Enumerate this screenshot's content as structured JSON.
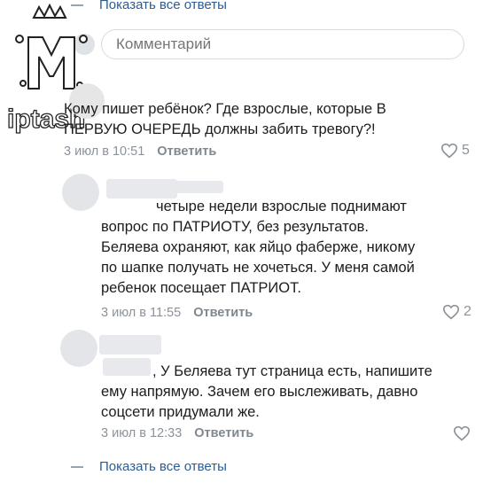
{
  "thread": {
    "show_all_top": "Показать все ответы",
    "show_all_bottom": "Показать все ответы",
    "comment_placeholder": "Комментарий"
  },
  "watermark": {
    "text": "iptash"
  },
  "comments": [
    {
      "text": "Кому пишет ребёнок? Где взрослые, которые В\nПЕРВУЮ ОЧЕРЕДЬ должны забить тревогу?!",
      "time": "3 июл в 10:51",
      "reply": "Ответить",
      "likes": "5"
    },
    {
      "text": "четыре недели взрослые поднимают\nвопрос по ПАТРИОТУ, без результатов.\nБеляева охраняют, как яйцо фаберже, никому\nпо шапке получать не хочеться. У меня самой\nребенок посещает ПАТРИОТ.",
      "time": "3 июл в 11:55",
      "reply": "Ответить",
      "likes": "2"
    },
    {
      "text": ", У Беляева тут страница есть, напишите\nему напрямую. Зачем его выслеживать, давно\nсоцсети придумали же.",
      "time": "3 июл в 12:33",
      "reply": "Ответить",
      "likes": ""
    }
  ],
  "colors": {
    "link": "#2b5c94",
    "meta": "#8b929a"
  },
  "icons": {
    "like": "heart-outline-icon"
  }
}
